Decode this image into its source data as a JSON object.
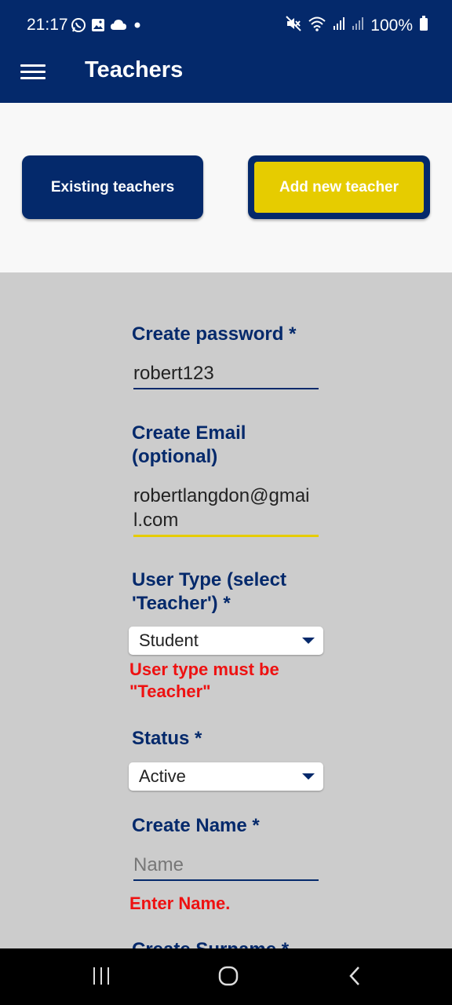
{
  "status_bar": {
    "time": "21:17",
    "left_icons": [
      "whatsapp-icon",
      "image-icon",
      "cloud-icon",
      "dot-icon"
    ],
    "right_icons": [
      "mute-icon",
      "wifi-icon",
      "signal-icon",
      "signal-icon",
      "battery-icon"
    ],
    "battery": "100%"
  },
  "app_bar": {
    "title": "Teachers",
    "menu_icon": "hamburger-menu-icon"
  },
  "tabs": {
    "existing_label": "Existing teachers",
    "add_label": "Add new teacher"
  },
  "form": {
    "password": {
      "label": "Create password *",
      "value": "robert123"
    },
    "email": {
      "label": "Create Email (optional)",
      "value": "robertlangdon@gmail.com"
    },
    "user_type": {
      "label": "User Type (select 'Teacher') *",
      "value": "Student",
      "error": "User type must be \"Teacher\""
    },
    "status": {
      "label": "Status *",
      "value": "Active"
    },
    "name": {
      "label": "Create Name *",
      "placeholder": "Name",
      "error": "Enter Name."
    },
    "surname": {
      "label": "Create Surname *"
    }
  },
  "nav_bar": {
    "icons": [
      "recent-apps-icon",
      "home-icon",
      "back-icon"
    ]
  },
  "colors": {
    "primary": "#04296b",
    "accent": "#e6cc00",
    "error": "#ee1111",
    "background": "#cccccc"
  }
}
